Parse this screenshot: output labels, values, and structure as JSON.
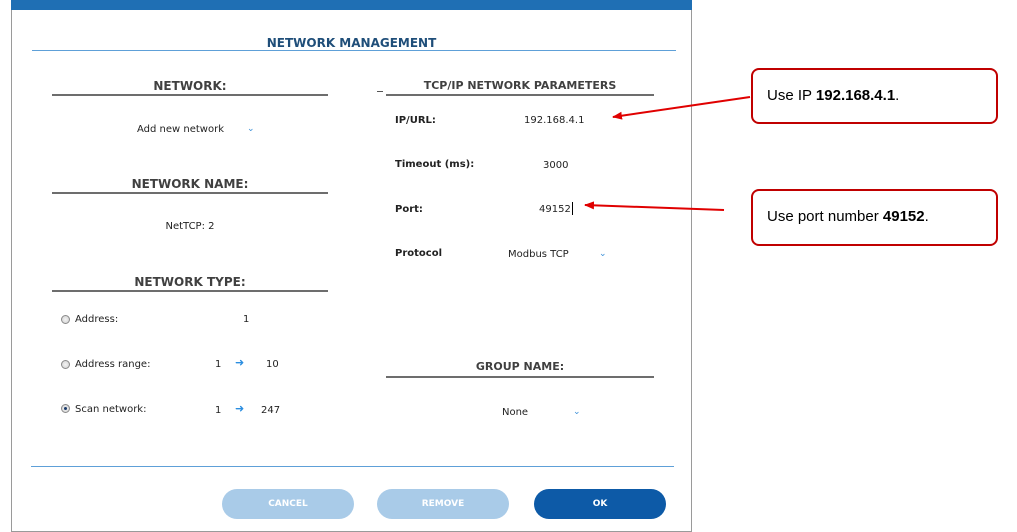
{
  "dialog": {
    "title": "NETWORK MANAGEMENT",
    "network": {
      "heading": "NETWORK:",
      "selected": "Add new network"
    },
    "network_name": {
      "heading": "NETWORK NAME:",
      "value": "NetTCP: 2"
    },
    "network_type": {
      "heading": "NETWORK TYPE:",
      "address_label": "Address:",
      "address_value": "1",
      "range_label": "Address range:",
      "range_from": "1",
      "range_to": "10",
      "scan_label": "Scan network:",
      "scan_from": "1",
      "scan_to": "247",
      "selected": "scan"
    },
    "tcpip": {
      "heading": "TCP/IP NETWORK PARAMETERS",
      "ip_label": "IP/URL:",
      "ip_value": "192.168.4.1",
      "timeout_label": "Timeout (ms):",
      "timeout_value": "3000",
      "port_label": "Port:",
      "port_value": "49152",
      "protocol_label": "Protocol",
      "protocol_value": "Modbus TCP"
    },
    "group": {
      "heading": "GROUP NAME:",
      "selected": "None"
    },
    "buttons": {
      "cancel": "CANCEL",
      "remove": "REMOVE",
      "ok": "OK"
    }
  },
  "callouts": {
    "ip_prefix": "Use IP ",
    "ip_bold": "192.168.4.1",
    "ip_suffix": ".",
    "port_prefix": "Use port number ",
    "port_bold": "49152",
    "port_suffix": "."
  },
  "colors": {
    "accent": "#1f6fb4",
    "primary_button": "#0d5aa7",
    "disabled_button": "#a9cbe8",
    "callout_border": "#c00000",
    "arrow": "#e00000"
  },
  "icons": {
    "dropdown": "chevron-down-icon",
    "range_arrow": "arrow-right-icon",
    "radio": "radio-icon"
  }
}
